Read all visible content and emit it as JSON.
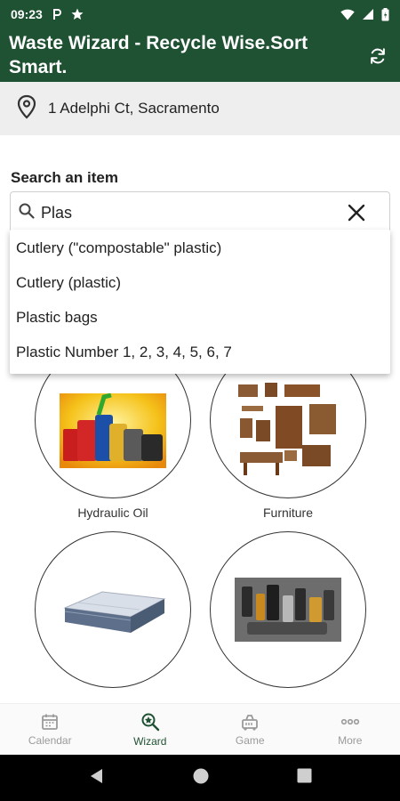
{
  "status_bar": {
    "time": "09:23",
    "icons": [
      "parking-icon",
      "star-icon",
      "wifi-icon",
      "signal-icon",
      "battery-icon"
    ]
  },
  "app_bar": {
    "title": "Waste Wizard - Recycle Wise.Sort Smart.",
    "refresh_icon": "refresh-icon"
  },
  "location": {
    "icon": "location-pin-icon",
    "address": "1 Adelphi Ct, Sacramento"
  },
  "search": {
    "label": "Search an item",
    "value": "Plas",
    "suggestions": [
      "Cutlery (\"compostable\" plastic)",
      "Cutlery (plastic)",
      "Plastic bags",
      "Plastic Number 1, 2, 3, 4, 5, 6, 7"
    ]
  },
  "grid": {
    "items": [
      {
        "label": "Hydraulic Oil",
        "icon": "oil-containers-image"
      },
      {
        "label": "Furniture",
        "icon": "furniture-image"
      },
      {
        "label": "",
        "icon": "mattress-image"
      },
      {
        "label": "",
        "icon": "batteries-image"
      }
    ]
  },
  "bottom_nav": {
    "items": [
      {
        "label": "Calendar",
        "icon": "calendar-icon",
        "active": false
      },
      {
        "label": "Wizard",
        "icon": "wizard-icon",
        "active": true
      },
      {
        "label": "Game",
        "icon": "game-icon",
        "active": false
      },
      {
        "label": "More",
        "icon": "more-icon",
        "active": false
      }
    ]
  },
  "colors": {
    "primary": "#1f5133",
    "inactive": "#9a9a9a",
    "location_bg": "#eeeeee"
  }
}
